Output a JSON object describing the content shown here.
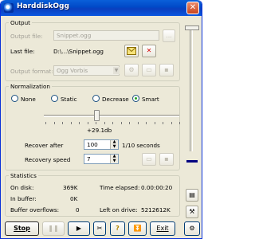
{
  "window": {
    "title": "HarddiskOgg"
  },
  "output": {
    "legend": "Output",
    "file_label": "Output file:",
    "file_value": "Snippet.ogg",
    "browse_label": "...",
    "last_label": "Last file:",
    "last_value": "D:\\...\\Snippet.ogg",
    "format_label": "Output format:",
    "format_value": "Ogg Vorbis"
  },
  "normalization": {
    "legend": "Normalization",
    "modes": [
      "None",
      "Static",
      "Decrease",
      "Smart"
    ],
    "selected": "Smart",
    "gain_value": "+29.1db",
    "recover_label": "Recover after",
    "recover_value": "100",
    "recover_unit": "1/10 seconds",
    "speed_label": "Recovery speed",
    "speed_value": "7"
  },
  "statistics": {
    "legend": "Statistics",
    "on_disk_label": "On disk:",
    "on_disk_value": "369K",
    "buffer_label": "In buffer:",
    "buffer_value": "0K",
    "overflow_label": "Buffer overflows:",
    "overflow_value": "0",
    "elapsed_label": "Time elapsed:",
    "elapsed_value": "0.00:00:20",
    "left_label": "Left on drive:",
    "left_value": "5212612K"
  },
  "toolbar": {
    "stop_label": "Stop",
    "exit_label": "Exit"
  },
  "colors": {
    "title_bar": "#0a5fd9",
    "window_bg": "#ece9d8",
    "level_meter": "#000080"
  }
}
